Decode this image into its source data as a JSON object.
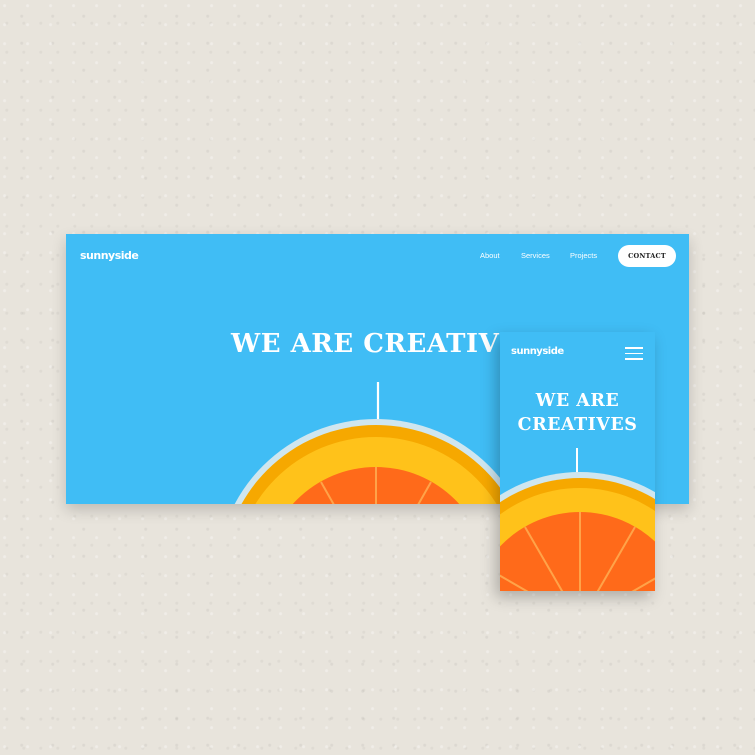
{
  "desktop": {
    "logo": "sunnyside",
    "nav": [
      "About",
      "Services",
      "Projects"
    ],
    "contact": "CONTACT",
    "headline": "WE ARE CREATIVES"
  },
  "mobile": {
    "logo": "sunnyside",
    "headline_line1": "WE ARE",
    "headline_line2": "CREATIVES"
  },
  "icons": [
    "arrow-down-icon",
    "hamburger-menu-icon"
  ],
  "colors": {
    "page_background": "#e8e4dc",
    "hero_blue": "#40bdf5",
    "orange": "#ff6f1f",
    "white": "#ffffff"
  }
}
